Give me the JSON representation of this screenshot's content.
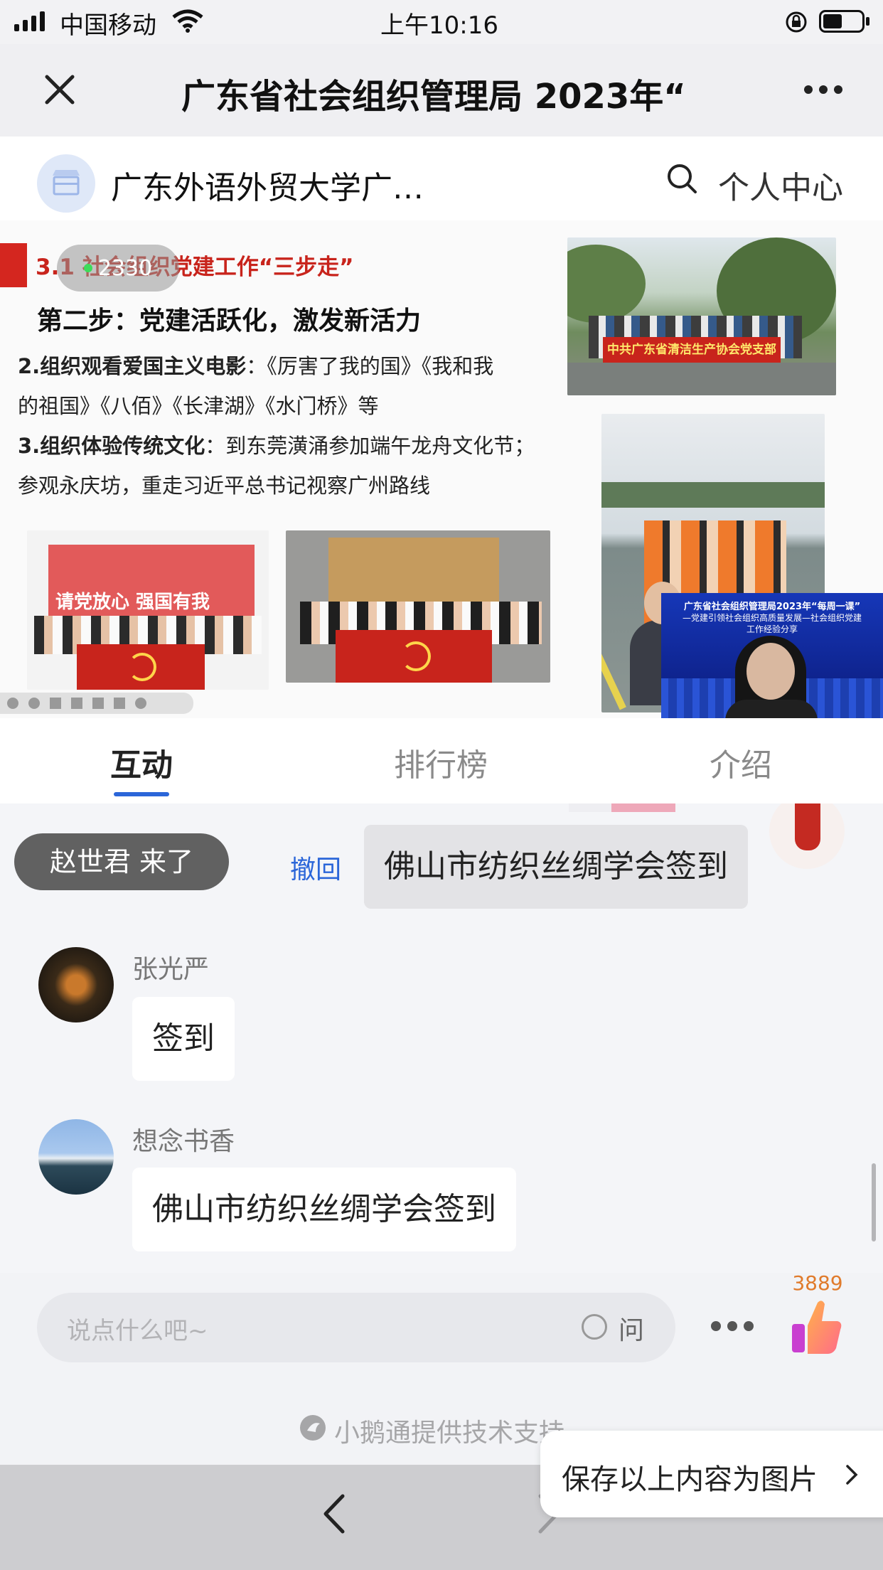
{
  "status_bar": {
    "carrier": "中国移动",
    "time": "上午10:16"
  },
  "nav": {
    "title": "广东省社会组织管理局 2023年“"
  },
  "shop": {
    "name": "广东外语外贸大学广…",
    "personal_center": "个人中心"
  },
  "slide": {
    "live_badge": "2330",
    "section_title": "3.1 社会组织党建工作“三步走”",
    "step_title": "第二步：党建活跃化，激发新活力",
    "item2_bold": "2.组织观看爱国主义电影",
    "item2_rest": "：《厉害了我的国》《我和我",
    "item2_line2": "的祖国》《八佰》《长津湖》《水门桥》等",
    "item3_bold": "3.组织体验传统文化",
    "item3_rest": "：到东莞潢涌参加端午龙舟文化节；",
    "item3_line2": "参观永庆坊，重走习近平总书记视察广州路线",
    "photo_banner_text": "中共广东省清洁生产协会党支部",
    "photo_wall_text": "请党放心 强国有我",
    "video_title_1": "广东省社会组织管理局2023年“每周一课”",
    "video_title_2": "—党建引领社会组织高质量发展—社会组织党建",
    "video_title_3": "工作经验分享"
  },
  "tabs": [
    {
      "label": "互动",
      "active": true
    },
    {
      "label": "排行榜",
      "active": false
    },
    {
      "label": "介绍",
      "active": false
    }
  ],
  "chat": {
    "join_notice": "赵世君 来了",
    "recall_label": "撤回",
    "own_message": "佛山市纺织丝绸学会签到",
    "messages": [
      {
        "name": "张光严",
        "text": "签到"
      },
      {
        "name": "想念书香",
        "text": "佛山市纺织丝绸学会签到"
      }
    ]
  },
  "input": {
    "placeholder": "说点什么吧~",
    "ask_label": "问",
    "like_count": "3889"
  },
  "support_text": "小鹅通提供技术支持",
  "save_button": "保存以上内容为图片",
  "colors": {
    "accent_blue": "#2b66d9",
    "party_red": "#c8241c",
    "like_count_orange": "#e07b2c"
  }
}
